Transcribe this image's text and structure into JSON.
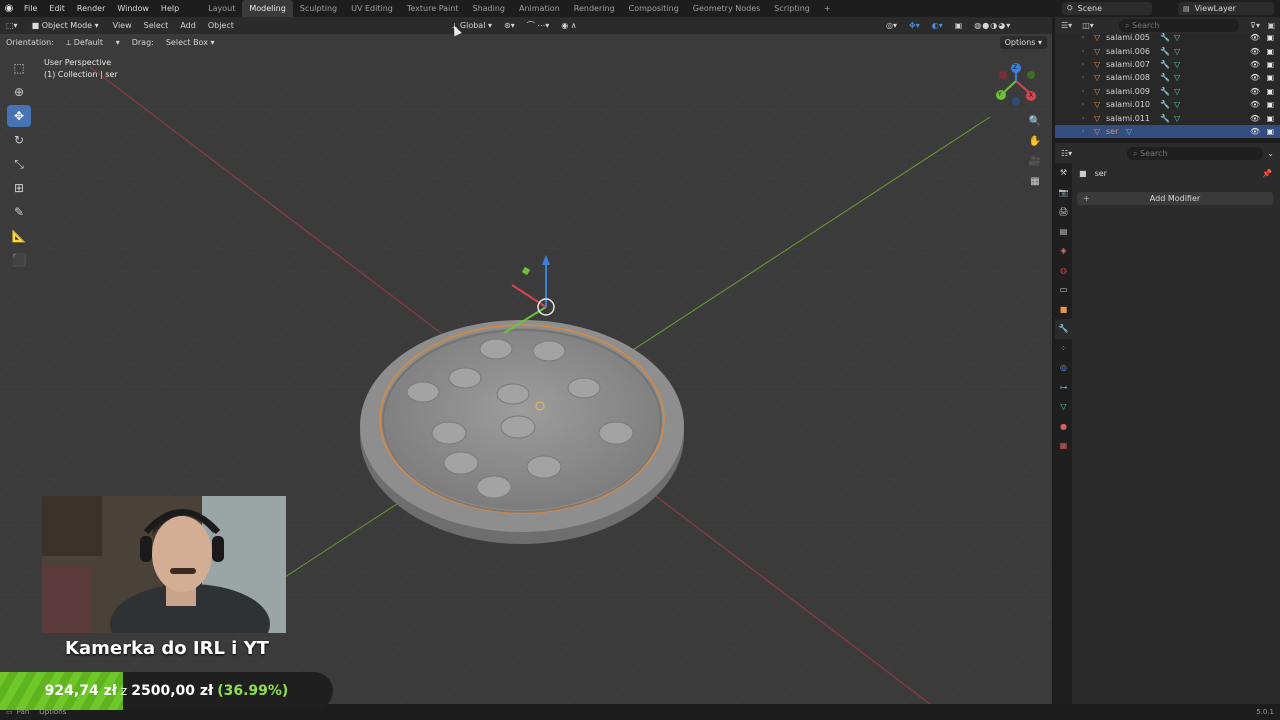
{
  "menu": {
    "file": "File",
    "edit": "Edit",
    "render": "Render",
    "window": "Window",
    "help": "Help"
  },
  "workspaces": [
    "Layout",
    "Modeling",
    "Sculpting",
    "UV Editing",
    "Texture Paint",
    "Shading",
    "Animation",
    "Rendering",
    "Compositing",
    "Geometry Nodes",
    "Scripting"
  ],
  "workspace_add": "+",
  "active_workspace": "Modeling",
  "scene": {
    "label": "Scene",
    "view_layer": "ViewLayer"
  },
  "viewport": {
    "mode": "Object Mode",
    "menus": {
      "view": "View",
      "select": "Select",
      "add": "Add",
      "object": "Object"
    },
    "orientation_global": "Global",
    "orientation_label": "Orientation:",
    "orientation_value": "Default",
    "drag_label": "Drag:",
    "drag_value": "Select Box",
    "options": "Options",
    "perspective": "User Perspective",
    "collection": "(1) Collection | ser",
    "axes": {
      "x": "X",
      "y": "Y",
      "z": "Z"
    }
  },
  "outliner": {
    "search_placeholder": "Search",
    "rows": [
      {
        "label": "salami.005"
      },
      {
        "label": "salami.006"
      },
      {
        "label": "salami.007"
      },
      {
        "label": "salami.008"
      },
      {
        "label": "salami.009"
      },
      {
        "label": "salami.010"
      },
      {
        "label": "salami.011"
      },
      {
        "label": "ser"
      }
    ]
  },
  "properties": {
    "search_placeholder": "Search",
    "object_name": "ser",
    "add_modifier": "Add Modifier"
  },
  "overlay": {
    "goal_title": "Kamerka do IRL i YT",
    "goal_current": "924,74 zł",
    "goal_sep": "z",
    "goal_target": "2500,00 zł",
    "goal_percent": "(36.99%)",
    "goal_progress": 0.3699
  },
  "statusbar": {
    "pan": "Pan",
    "options": "Options",
    "version": "5.0.1"
  },
  "colors": {
    "accent": "#4772b3",
    "selection": "#e9954a",
    "goal": "#6fc82a"
  }
}
